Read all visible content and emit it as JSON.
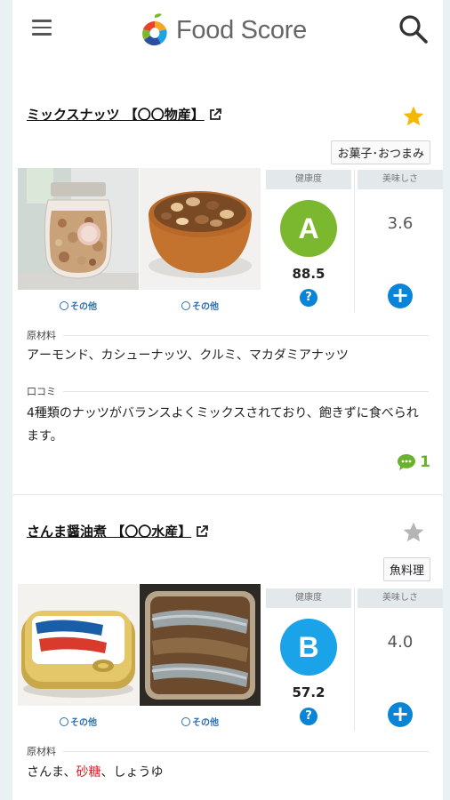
{
  "header": {
    "app_name": "Food Score",
    "menu_icon": "hamburger-menu-icon",
    "search_icon": "search-icon"
  },
  "colors": {
    "grade_a": "#7cb82f",
    "grade_b": "#1aa3e8",
    "star_on": "#f5b800",
    "star_off": "#b5b5b5",
    "accent_blue": "#0a84d6",
    "comment_green": "#6ab22e"
  },
  "products": [
    {
      "title": "ミックスナッツ 【〇〇物産】",
      "favorited": true,
      "category": "お菓子･おつまみ",
      "other_links": [
        "その他",
        "その他"
      ],
      "health_header": "健康度",
      "taste_header": "美味しさ",
      "grade": "A",
      "health_score": "88.5",
      "help": "?",
      "taste_score": "3.6",
      "add": "+",
      "ingredients_label": "原材料",
      "ingredients": "アーモンド、カシューナッツ、クルミ、マカダミアナッツ",
      "review_label": "口コミ",
      "review": "4種類のナッツがバランスよくミックスされており、飽きずに食べられます。",
      "comment_count": "1"
    },
    {
      "title": "さんま醤油煮 【〇〇水産】",
      "favorited": false,
      "category": "魚料理",
      "other_links": [
        "その他",
        "その他"
      ],
      "health_header": "健康度",
      "taste_header": "美味しさ",
      "grade": "B",
      "health_score": "57.2",
      "help": "?",
      "taste_score": "4.0",
      "add": "+",
      "ingredients_label": "原材料",
      "ingredients_parts": [
        "さんま、",
        "砂糖",
        "、しょうゆ"
      ]
    }
  ]
}
